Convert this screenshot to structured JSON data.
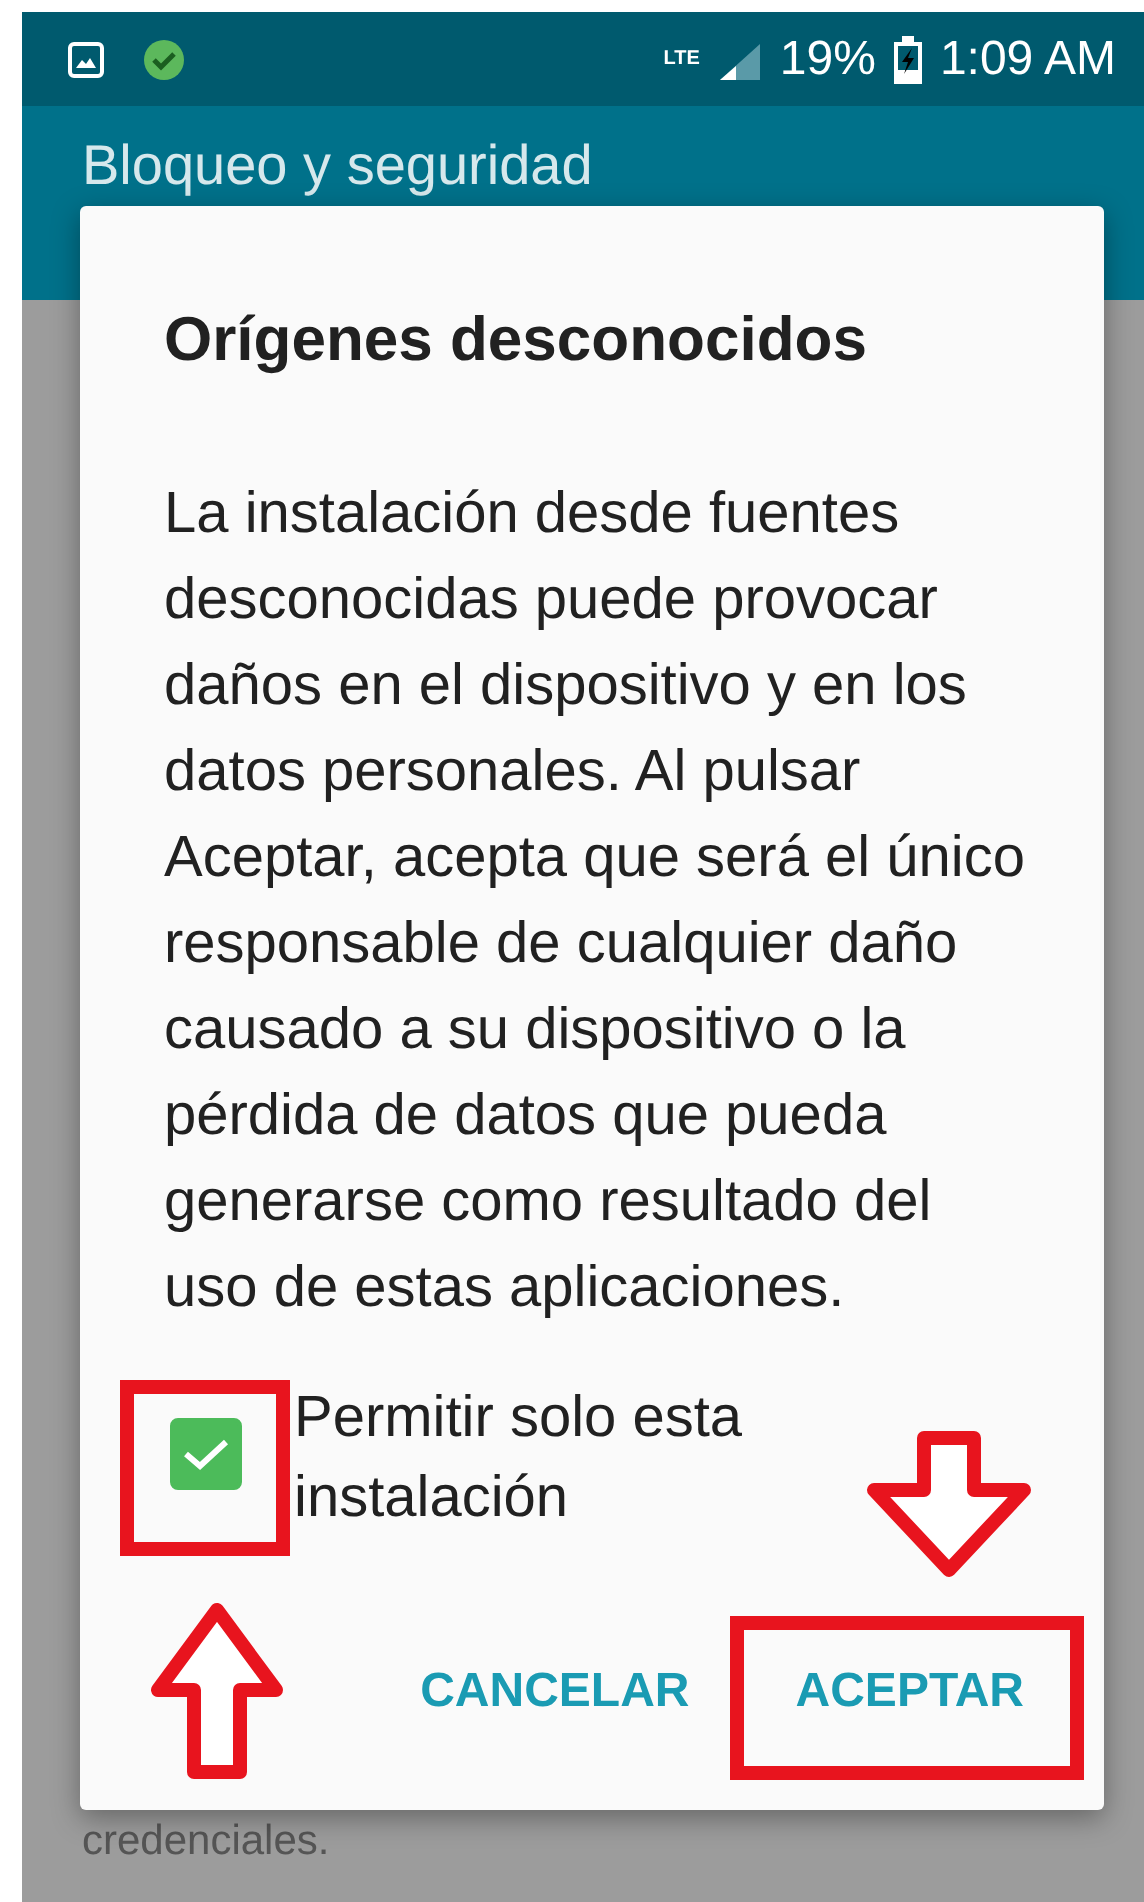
{
  "status_bar": {
    "network": "LTE",
    "battery": "19%",
    "time": "1:09 AM"
  },
  "app_bar": {
    "title": "Bloqueo y seguridad"
  },
  "background_text": "credenciales.",
  "dialog": {
    "title": "Orígenes desconocidos",
    "message": "La instalación desde fuentes desconocidas puede provocar daños en el dispositivo y en los datos personales. Al pulsar Aceptar, acepta que será el único responsable de cualquier daño causado a su dispositivo o la pérdida de datos que pueda generarse como resultado del uso de estas aplicaciones.",
    "checkbox": {
      "label": "Permitir solo esta instalación",
      "checked": true
    },
    "buttons": [
      "CANCELAR",
      "ACEPTAR"
    ]
  }
}
